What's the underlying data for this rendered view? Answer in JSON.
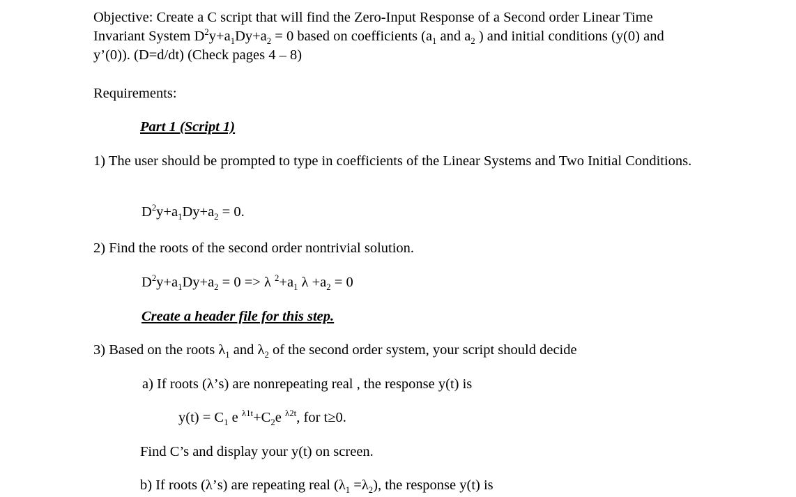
{
  "document": {
    "background_color": "#ffffff",
    "text_color": "#000000",
    "objective": {
      "line1_a": "Objective: Create a C script that will find the Zero-Input Response of a Second order Linear Time Invariant System D",
      "line1_sup": "2",
      "line1_b": "y+a",
      "line1_sub1": "1",
      "line1_c": "Dy+a",
      "line1_sub2": "2",
      "line1_d": " = 0 based on coefficients (a",
      "line1_sub3": "1",
      "line1_e": " and a",
      "line1_sub4": "2",
      "line1_f": " ) and initial conditions (y(0) and y’(0)).  (D=d/dt) (Check pages 4 – 8)"
    },
    "requirements_label": "Requirements:",
    "part1_heading": "Part 1 (Script 1)",
    "item1": {
      "text": "1) The user should be prompted to type in coefficients of the Linear Systems and Two Initial Conditions."
    },
    "eq1": {
      "d": "D",
      "d_sup": "2",
      "y_a": "y+a",
      "sub1": "1",
      "dy": "Dy+a",
      "sub2": "2",
      "tail": " = 0."
    },
    "item2": {
      "text": "2) Find the roots of the second order nontrivial solution."
    },
    "eq2": {
      "d": "D",
      "d_sup": "2",
      "y_a": "y+a",
      "sub1": "1",
      "dy": "Dy+a",
      "sub2": "2",
      "mid": " = 0 => λ ",
      "lam_sup": "2",
      "plus_a": "+a",
      "sub3": "1",
      "lam2": " λ +a",
      "sub4": "2",
      "tail": " = 0"
    },
    "header_file_heading": "Create a header file for this step.",
    "item3": {
      "pre": "3) Based on the roots λ",
      "sub1": "1",
      "mid": " and λ",
      "sub2": "2",
      "post": " of the second order system, your script should decide"
    },
    "item3a": {
      "text": "a) If roots (λ’s)  are nonrepeating real , the response y(t) is"
    },
    "eq3": {
      "pre": "y(t) = C",
      "sub1": "1",
      "mid1": " e ",
      "exp1": "λ1t",
      "mid2": "+C",
      "sub2": "2",
      "mid3": "e ",
      "exp2": "λ2t",
      "tail": ", for t≥0."
    },
    "find_cs": {
      "text": "Find C’s and display your y(t) on screen."
    },
    "item3b": {
      "pre": "b) If roots (λ’s)  are repeating real (λ",
      "sub1": "1",
      "mid": " =λ",
      "sub2": "2",
      "post": "), the response y(t) is"
    }
  }
}
